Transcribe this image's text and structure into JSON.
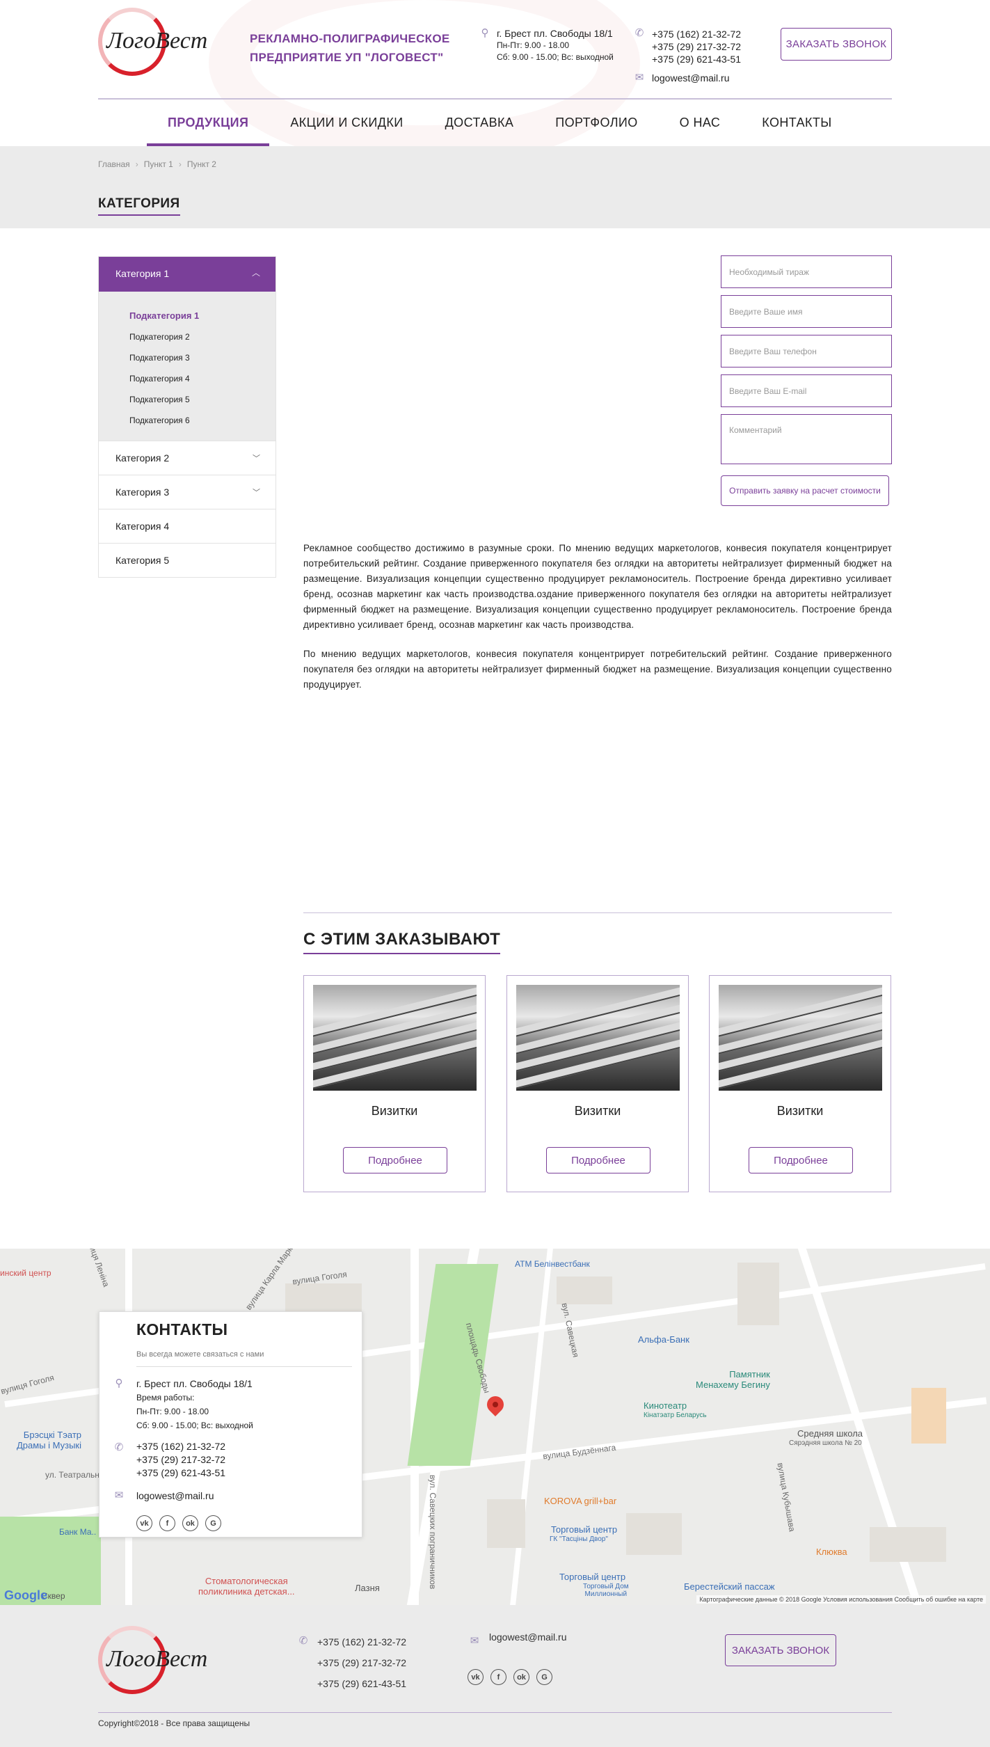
{
  "logo": {
    "text": "ЛогоВест"
  },
  "header": {
    "company_line1": "РЕКЛАМНО-ПОЛИГРАФИЧЕСКОЕ",
    "company_line2": "ПРЕДПРИЯТИЕ УП \"ЛОГОВЕСТ\"",
    "address": "г. Брест пл. Свободы 18/1",
    "hours1": "Пн-Пт: 9.00 - 18.00",
    "hours2": "Сб: 9.00 - 15.00; Вс: выходной",
    "phones": [
      "+375 (162) 21-32-72",
      "+375 (29) 217-32-72",
      "+375 (29) 621-43-51"
    ],
    "email": "logowest@mail.ru",
    "call_button": "ЗАКАЗАТЬ ЗВОНОК"
  },
  "nav": [
    "ПРОДУКЦИЯ",
    "АКЦИИ И СКИДКИ",
    "ДОСТАВКА",
    "ПОРТФОЛИО",
    "О НАС",
    "КОНТАКТЫ"
  ],
  "breadcrumb": [
    "Главная",
    "Пункт 1",
    "Пункт 2"
  ],
  "page_title": "КАТЕГОРИЯ",
  "sidebar": {
    "open_category": "Категория 1",
    "subcategories": [
      "Подкатегория 1",
      "Подкатегория 2",
      "Подкатегория 3",
      "Подкатегория 4",
      "Подкатегория 5",
      "Подкатегория 6"
    ],
    "categories": [
      "Категория 2",
      "Категория 3",
      "Категория 4",
      "Категория 5"
    ]
  },
  "form": {
    "circulation": "Необходимый тираж",
    "name": "Введите Ваше имя",
    "phone": "Введите Ваш телефон",
    "email": "Введите Ваш E-mail",
    "comment": "Комментарий",
    "submit": "Отправить заявку на расчет стоимости"
  },
  "article": {
    "p1": "Рекламное сообщество достижимо в разумные сроки. По мнению ведущих маркетологов, конвесия покупателя концентрирует потребительский рейтинг. Создание приверженного покупателя без оглядки на авторитеты нейтрализует фирменный бюджет на размещение. Визуализация концепции существенно продуцирует рекламоноситель. Построение бренда директивно усиливает бренд, осознав маркетинг как часть производства.оздание приверженного покупателя без оглядки на авторитеты нейтрализует фирменный бюджет на размещение. Визуализация концепции существенно продуцирует рекламоноситель. Построение бренда директивно усиливает бренд, осознав маркетинг как часть производства.",
    "p2": "По мнению ведущих маркетологов, конвесия покупателя концентрирует потребительский рейтинг. Создание приверженного покупателя без оглядки на авторитеты нейтрализует фирменный бюджет на размещение. Визуализация концепции существенно продуцирует."
  },
  "related": {
    "title": "С ЭТИМ ЗАКАЗЫВАЮТ",
    "cards": [
      {
        "name": "Визитки",
        "button": "Подробнее"
      },
      {
        "name": "Визитки",
        "button": "Подробнее"
      },
      {
        "name": "Визитки",
        "button": "Подробнее"
      }
    ]
  },
  "map": {
    "labels": {
      "a": "вулиця Леніна",
      "b": "вулиця Гоголя",
      "c": "вулица Карла Маркса",
      "d": "вулица Гоголя",
      "e": "вул. Савецкая",
      "f": "вулица Будзённага",
      "g": "вулица Кубышава",
      "h": "ул. Театральна",
      "i": "площадь Свободы",
      "j": "вул. Савецких пограничников"
    },
    "pois": {
      "alfa": "Альфа-Банк",
      "monument": "Памятник\nМенахему Бегину",
      "cinema": "Кинотеатр",
      "cinema_sub": "Кінатэатр Беларусь",
      "school": "Средняя школа",
      "school_sub": "Сярэдняя школа № 20",
      "theatre": "Брэсцкі Тэатр\nДрамы і Музыкі",
      "korova": "KOROVA grill+bar",
      "tc1": "Торговый центр",
      "tc1_sub": "ГК \"Тасціны Двор\"",
      "tc2": "Торговый центр",
      "tc2_sub": "Торговый Дом\nМиллионный",
      "klyukva": "Клюква",
      "berest": "Берестейский пассаж",
      "clinic": "Стоматологическая\nполиклиника детская...",
      "lazna": "Лазня",
      "atm": "ATM Белінвестбанк",
      "bank": "Банк Ма..",
      "centre": "инский центр",
      "skver": "Сквер"
    },
    "footer": "Картографические данные © 2018 Google    Условия использования    Сообщить об ошибке на карте",
    "google": "Google"
  },
  "contacts": {
    "title": "КОНТАКТЫ",
    "subtitle": "Вы всегда можете связаться с нами",
    "address": "г. Брест пл. Свободы 18/1",
    "work_label": "Время работы:",
    "hours1": "Пн-Пт: 9.00 - 18.00",
    "hours2": "Сб: 9.00 - 15.00; Вс: выходной",
    "phones": [
      "+375 (162) 21-32-72",
      "+375 (29) 217-32-72",
      "+375 (29) 621-43-51"
    ],
    "email": "logowest@mail.ru"
  },
  "social": [
    "vk",
    "f",
    "ok",
    "G"
  ],
  "footer": {
    "phones": [
      "+375 (162) 21-32-72",
      "+375 (29) 217-32-72",
      "+375 (29) 621-43-51"
    ],
    "email": "logowest@mail.ru",
    "call_button": "ЗАКАЗАТЬ ЗВОНОК",
    "copyright": "Copyright©2018 - Все права защищены"
  },
  "colors": {
    "accent": "#7a3f99",
    "band": "#ebebeb",
    "logo_red": "#d8212b"
  },
  "icons": [
    "location-pin-icon",
    "phone-icon",
    "mail-icon",
    "chevron-up-icon",
    "chevron-down-icon",
    "map-pin-icon"
  ]
}
